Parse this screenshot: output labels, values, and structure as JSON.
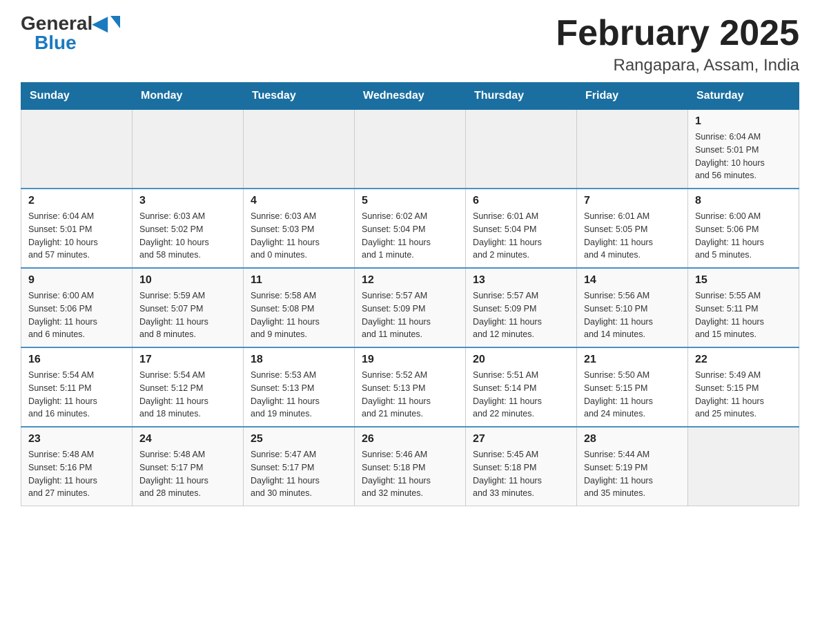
{
  "logo": {
    "general": "General",
    "blue": "Blue"
  },
  "title": "February 2025",
  "subtitle": "Rangapara, Assam, India",
  "days_of_week": [
    "Sunday",
    "Monday",
    "Tuesday",
    "Wednesday",
    "Thursday",
    "Friday",
    "Saturday"
  ],
  "weeks": [
    [
      {
        "day": "",
        "info": ""
      },
      {
        "day": "",
        "info": ""
      },
      {
        "day": "",
        "info": ""
      },
      {
        "day": "",
        "info": ""
      },
      {
        "day": "",
        "info": ""
      },
      {
        "day": "",
        "info": ""
      },
      {
        "day": "1",
        "info": "Sunrise: 6:04 AM\nSunset: 5:01 PM\nDaylight: 10 hours\nand 56 minutes."
      }
    ],
    [
      {
        "day": "2",
        "info": "Sunrise: 6:04 AM\nSunset: 5:01 PM\nDaylight: 10 hours\nand 57 minutes."
      },
      {
        "day": "3",
        "info": "Sunrise: 6:03 AM\nSunset: 5:02 PM\nDaylight: 10 hours\nand 58 minutes."
      },
      {
        "day": "4",
        "info": "Sunrise: 6:03 AM\nSunset: 5:03 PM\nDaylight: 11 hours\nand 0 minutes."
      },
      {
        "day": "5",
        "info": "Sunrise: 6:02 AM\nSunset: 5:04 PM\nDaylight: 11 hours\nand 1 minute."
      },
      {
        "day": "6",
        "info": "Sunrise: 6:01 AM\nSunset: 5:04 PM\nDaylight: 11 hours\nand 2 minutes."
      },
      {
        "day": "7",
        "info": "Sunrise: 6:01 AM\nSunset: 5:05 PM\nDaylight: 11 hours\nand 4 minutes."
      },
      {
        "day": "8",
        "info": "Sunrise: 6:00 AM\nSunset: 5:06 PM\nDaylight: 11 hours\nand 5 minutes."
      }
    ],
    [
      {
        "day": "9",
        "info": "Sunrise: 6:00 AM\nSunset: 5:06 PM\nDaylight: 11 hours\nand 6 minutes."
      },
      {
        "day": "10",
        "info": "Sunrise: 5:59 AM\nSunset: 5:07 PM\nDaylight: 11 hours\nand 8 minutes."
      },
      {
        "day": "11",
        "info": "Sunrise: 5:58 AM\nSunset: 5:08 PM\nDaylight: 11 hours\nand 9 minutes."
      },
      {
        "day": "12",
        "info": "Sunrise: 5:57 AM\nSunset: 5:09 PM\nDaylight: 11 hours\nand 11 minutes."
      },
      {
        "day": "13",
        "info": "Sunrise: 5:57 AM\nSunset: 5:09 PM\nDaylight: 11 hours\nand 12 minutes."
      },
      {
        "day": "14",
        "info": "Sunrise: 5:56 AM\nSunset: 5:10 PM\nDaylight: 11 hours\nand 14 minutes."
      },
      {
        "day": "15",
        "info": "Sunrise: 5:55 AM\nSunset: 5:11 PM\nDaylight: 11 hours\nand 15 minutes."
      }
    ],
    [
      {
        "day": "16",
        "info": "Sunrise: 5:54 AM\nSunset: 5:11 PM\nDaylight: 11 hours\nand 16 minutes."
      },
      {
        "day": "17",
        "info": "Sunrise: 5:54 AM\nSunset: 5:12 PM\nDaylight: 11 hours\nand 18 minutes."
      },
      {
        "day": "18",
        "info": "Sunrise: 5:53 AM\nSunset: 5:13 PM\nDaylight: 11 hours\nand 19 minutes."
      },
      {
        "day": "19",
        "info": "Sunrise: 5:52 AM\nSunset: 5:13 PM\nDaylight: 11 hours\nand 21 minutes."
      },
      {
        "day": "20",
        "info": "Sunrise: 5:51 AM\nSunset: 5:14 PM\nDaylight: 11 hours\nand 22 minutes."
      },
      {
        "day": "21",
        "info": "Sunrise: 5:50 AM\nSunset: 5:15 PM\nDaylight: 11 hours\nand 24 minutes."
      },
      {
        "day": "22",
        "info": "Sunrise: 5:49 AM\nSunset: 5:15 PM\nDaylight: 11 hours\nand 25 minutes."
      }
    ],
    [
      {
        "day": "23",
        "info": "Sunrise: 5:48 AM\nSunset: 5:16 PM\nDaylight: 11 hours\nand 27 minutes."
      },
      {
        "day": "24",
        "info": "Sunrise: 5:48 AM\nSunset: 5:17 PM\nDaylight: 11 hours\nand 28 minutes."
      },
      {
        "day": "25",
        "info": "Sunrise: 5:47 AM\nSunset: 5:17 PM\nDaylight: 11 hours\nand 30 minutes."
      },
      {
        "day": "26",
        "info": "Sunrise: 5:46 AM\nSunset: 5:18 PM\nDaylight: 11 hours\nand 32 minutes."
      },
      {
        "day": "27",
        "info": "Sunrise: 5:45 AM\nSunset: 5:18 PM\nDaylight: 11 hours\nand 33 minutes."
      },
      {
        "day": "28",
        "info": "Sunrise: 5:44 AM\nSunset: 5:19 PM\nDaylight: 11 hours\nand 35 minutes."
      },
      {
        "day": "",
        "info": ""
      }
    ]
  ]
}
